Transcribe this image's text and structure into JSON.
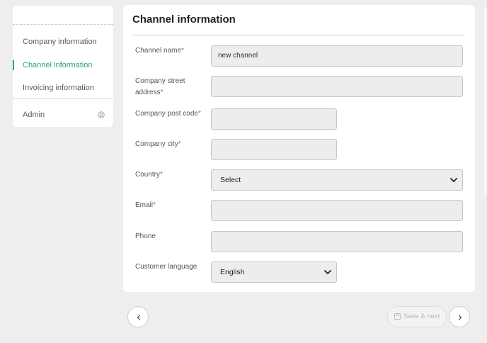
{
  "sidebar": {
    "items": [
      {
        "label": "Company information",
        "active": false
      },
      {
        "label": "Channel information",
        "active": true
      },
      {
        "label": "Invoicing information",
        "active": false
      }
    ],
    "admin_label": "Admin",
    "admin_icon": "user-circle-icon"
  },
  "form": {
    "title": "Channel information",
    "required_marker": "*",
    "fields": {
      "channel_name": {
        "label": "Channel name",
        "value": "new channel"
      },
      "street": {
        "label_line1": "Company street",
        "label_line2": "address",
        "value": ""
      },
      "post_code": {
        "label": "Company post code",
        "value": ""
      },
      "city": {
        "label": "Company city",
        "value": ""
      },
      "country": {
        "label": "Country",
        "selected": "Select"
      },
      "email": {
        "label": "Email",
        "value": ""
      },
      "phone": {
        "label": "Phone",
        "value": ""
      },
      "language": {
        "label": "Customer language",
        "selected": "English"
      }
    }
  },
  "nav": {
    "prev_icon": "chevron-left-icon",
    "next_icon": "chevron-right-icon",
    "save_next_label": "Save & next",
    "save_icon": "save-icon"
  },
  "colors": {
    "accent": "#2aa374",
    "required": "#d9534f",
    "background": "#eeeeee"
  }
}
